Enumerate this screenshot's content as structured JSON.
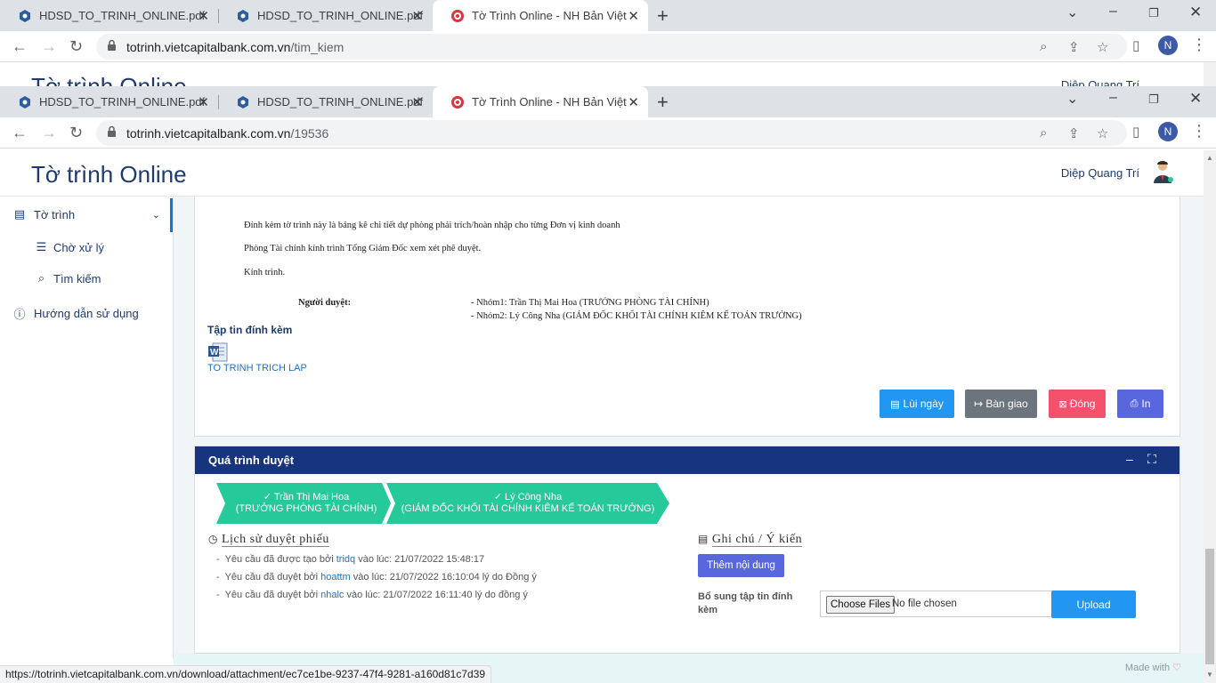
{
  "back_window": {
    "tabs": [
      {
        "label": "HDSD_TO_TRINH_ONLINE.pdf"
      },
      {
        "label": "HDSD_TO_TRINH_ONLINE.pdf"
      },
      {
        "label": "Tờ Trình Online - NH Bản Việt"
      }
    ],
    "url_host": "totrinh.vietcapitalbank.com.vn",
    "url_path": "/tim_kiem",
    "profile_initial": "N",
    "page_title": "Tờ trình Online",
    "user_name": "Diệp Quang Trí"
  },
  "browser": {
    "tabs": [
      {
        "label": "HDSD_TO_TRINH_ONLINE.pdf"
      },
      {
        "label": "HDSD_TO_TRINH_ONLINE.pdf"
      },
      {
        "label": "Tờ Trình Online - NH Bản Việt"
      }
    ],
    "url_host": "totrinh.vietcapitalbank.com.vn",
    "url_path": "/19536",
    "profile_initial": "N"
  },
  "header": {
    "title": "Tờ trình Online",
    "user_name": "Diệp Quang Trí"
  },
  "sidebar": {
    "items": [
      {
        "label": "Tờ trình"
      },
      {
        "label": "Chờ xử lý"
      },
      {
        "label": "Tìm kiếm"
      },
      {
        "label": "Hướng dẫn sử dụng"
      }
    ]
  },
  "document": {
    "line1": "Đính kèm tờ trình này là bảng kê chi tiết dự phòng phải trích/hoàn nhập cho từng Đơn vị kinh doanh",
    "line2": "Phòng Tài chính kính trình Tổng Giám Đốc xem xét phê duyệt.",
    "line3": "Kính trình.",
    "approver_label": "Người duyệt:",
    "approver_group1": "- Nhóm1: Trần Thị Mai Hoa (TRƯỞNG PHÒNG TÀI CHÍNH)",
    "approver_group2": "- Nhóm2: Lý Công Nha (GIÁM ĐỐC KHỐI TÀI CHÍNH KIÊM KẾ TOÁN TRƯỞNG)"
  },
  "attachments": {
    "label": "Tập tin đính kèm",
    "file_name": "TO TRINH TRICH LAP"
  },
  "actions": {
    "postpone": "Lùi ngày",
    "handover": "Bàn giao",
    "close": "Đóng",
    "print": "In"
  },
  "approval": {
    "title": "Quá trình duyệt",
    "steps": [
      {
        "name": "Trần Thị Mai Hoa",
        "role": "(TRƯỞNG PHÒNG TÀI CHÍNH)"
      },
      {
        "name": "Lý Công Nha",
        "role": "(GIÁM ĐỐC KHỐI TÀI CHÍNH KIÊM KẾ TOÁN TRƯỞNG)"
      }
    ],
    "history_title": "Lịch sử duyệt phiếu",
    "history": [
      {
        "prefix": "Yêu cầu đã được tạo bởi ",
        "user": "tridq",
        "suffix": " vào lúc: 21/07/2022 15:48:17"
      },
      {
        "prefix": "Yêu cầu đã duyệt bởi ",
        "user": "hoattm",
        "suffix": " vào lúc: 21/07/2022 16:10:04 lý do Đồng ý"
      },
      {
        "prefix": "Yêu cầu đã duyệt bởi ",
        "user": "nhalc",
        "suffix": " vào lúc: 21/07/2022 16:11:40 lý do đồng ý"
      }
    ],
    "notes_title": "Ghi chú / Ý kiến",
    "add_content": "Thêm nội dung",
    "file_label": "Bổ sung tập tin đính kèm",
    "choose_files": "Choose Files",
    "no_file": "No file chosen",
    "upload": "Upload"
  },
  "footer": {
    "made_with": "Made with"
  },
  "status_bar": {
    "url": "https://totrinh.vietcapitalbank.com.vn/download/attachment/ec7ce1be-9237-47f4-9281-a160d81c7d39"
  },
  "colors": {
    "brand_navy": "#1e3a6e",
    "panel_header": "#17357f",
    "step_green": "#26c999",
    "btn_blue": "#2196f3",
    "btn_gray": "#6c757d",
    "btn_red": "#f4516c",
    "btn_indigo": "#5867dd"
  }
}
